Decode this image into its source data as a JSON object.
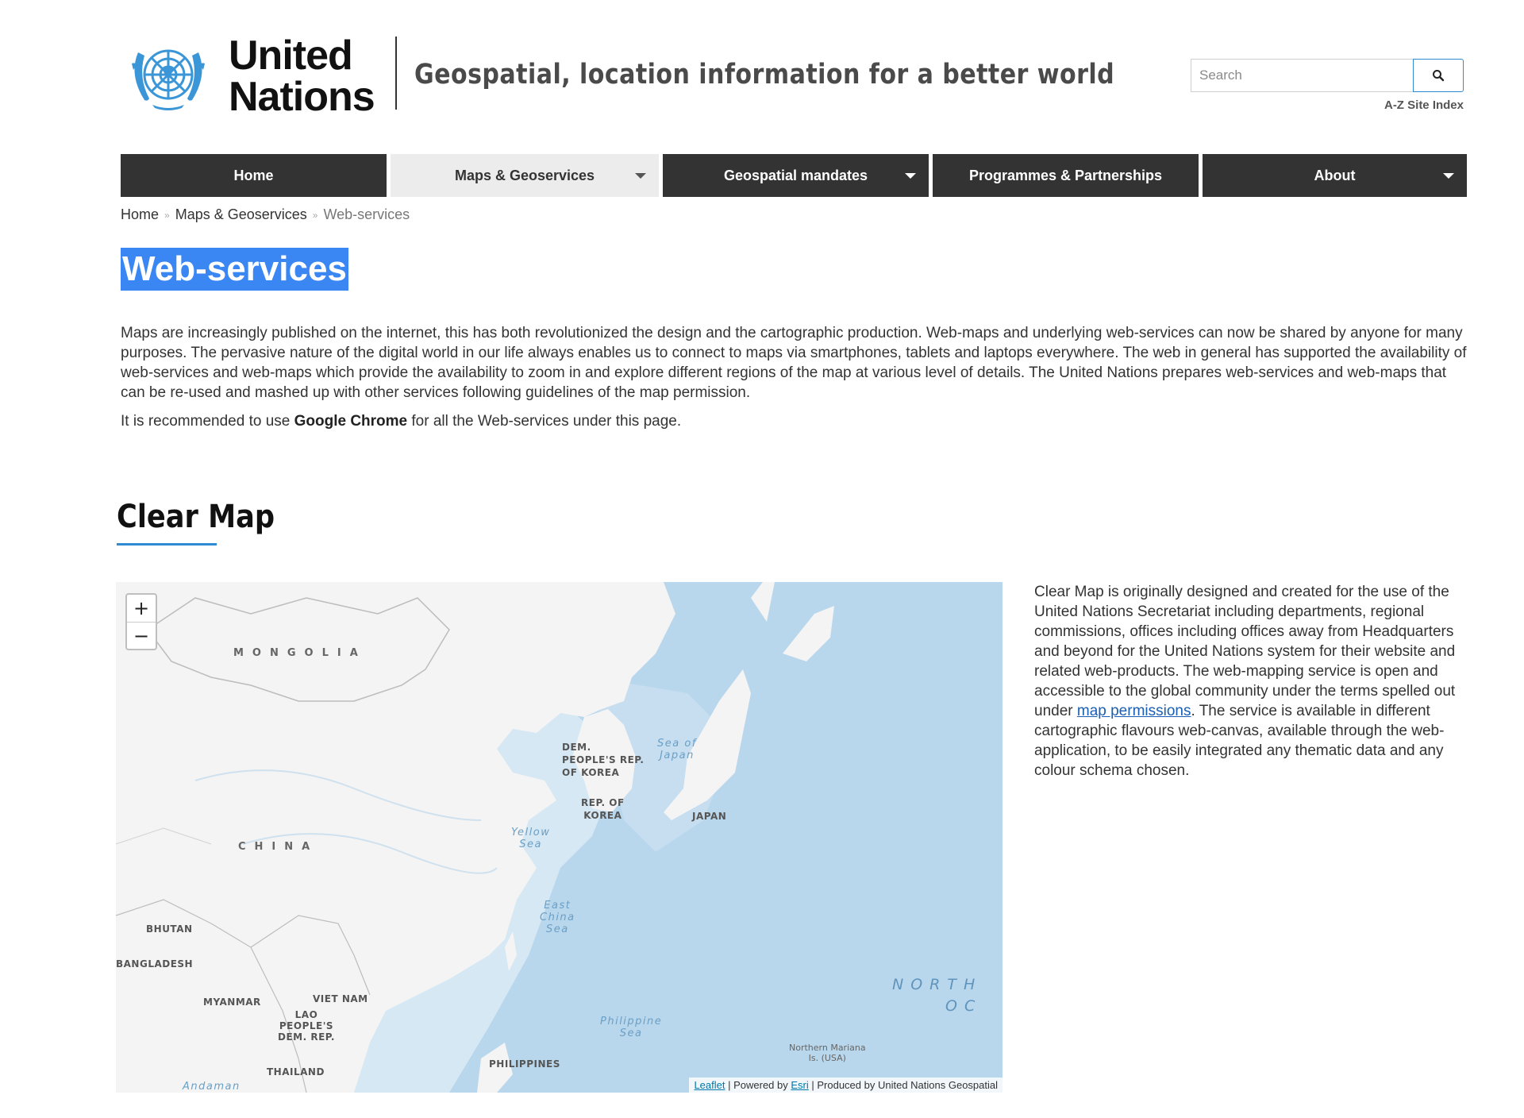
{
  "header": {
    "logo_line1": "United",
    "logo_line2": "Nations",
    "tagline": "Geospatial, location information for a better world",
    "search_placeholder": "Search",
    "az_index": "A-Z Site Index"
  },
  "nav": {
    "items": [
      {
        "label": "Home"
      },
      {
        "label": "Maps & Geoservices"
      },
      {
        "label": "Geospatial mandates"
      },
      {
        "label": "Programmes & Partnerships"
      },
      {
        "label": "About"
      }
    ]
  },
  "breadcrumb": {
    "items": [
      "Home",
      "Maps & Geoservices",
      "Web-services"
    ],
    "separator": "»"
  },
  "page": {
    "title": "Web-services",
    "intro": "Maps are increasingly published on the internet, this has both revolutionized the design and the cartographic production. Web-maps and underlying web-services can now be shared by anyone for many purposes. The pervasive nature of the digital world in our life always enables us to connect to maps via smartphones, tablets and laptops everywhere. The web in general has supported the availability of web-services and web-maps which provide the availability to zoom in and explore different regions of the map at various level of details. The United Nations prepares web-services and web-maps that can be re-used and mashed up with other services following guidelines of the map permission.",
    "recommend_pre": "It is recommended to use ",
    "recommend_bold": "Google Chrome",
    "recommend_post": " for all the Web-services under this page."
  },
  "section": {
    "title": "Clear Map",
    "text_pre": "Clear Map is originally designed and created for the use of the United Nations Secretariat including departments, regional commissions, offices including offices away from Headquarters and beyond for the United Nations system for their website and related web-products. The web-mapping service is open and accessible to the global community under the terms spelled out under ",
    "link": "map permissions",
    "text_post": ". The service is available in different cartographic flavours web-canvas, available through the web-application, to be easily integrated any thematic data and any colour schema chosen."
  },
  "map": {
    "zoom_in": "+",
    "zoom_out": "−",
    "labels": {
      "mongolia": "MONGOLIA",
      "china": "CHINA",
      "dprk": "DEM.\nPEOPLE'S REP.\nOF KOREA",
      "rok": "REP. OF\nKOREA",
      "japan": "JAPAN",
      "sea_japan": "Sea of\nJapan",
      "yellow_sea": "Yellow\nSea",
      "east_china_sea": "East\nChina\nSea",
      "bhutan": "BHUTAN",
      "bangladesh": "BANGLADESH",
      "myanmar": "MYANMAR",
      "viet_nam": "VIET NAM",
      "lao": "LAO\nPEOPLE'S\nDEM. REP.",
      "thailand": "THAILAND",
      "philippines": "PHILIPPINES",
      "philippine_sea": "Philippine\nSea",
      "north_pacific": "NORTH\nOC",
      "mariana": "Northern Mariana\nIs. (USA)",
      "andaman": "Andaman"
    },
    "attribution": {
      "leaflet": "Leaflet",
      "powered": " | Powered by ",
      "esri": "Esri",
      "produced": " | Produced by United Nations Geospatial"
    },
    "colors": {
      "land": "#f4f4f4",
      "ocean": "#b9d7ec",
      "shallow": "#d6e8f4",
      "border": "#bcbcbc"
    }
  },
  "colors": {
    "nav_dark": "#333333",
    "nav_active": "#ececec",
    "accent_blue": "#2e8bd4",
    "title_highlight": "#3a86f3"
  }
}
